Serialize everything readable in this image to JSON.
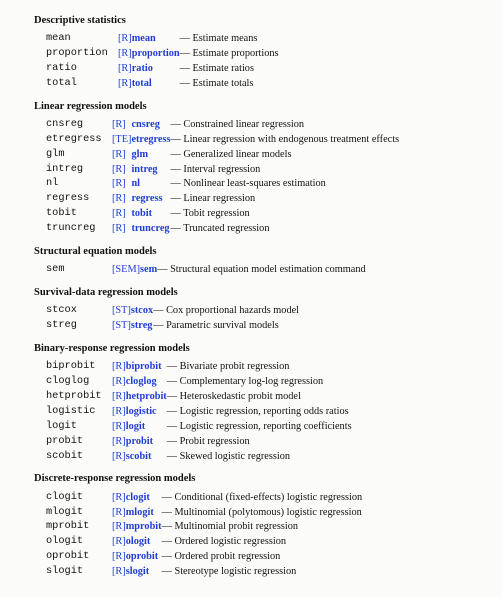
{
  "sections": [
    {
      "title": "Descriptive statistics",
      "cmdWidth": 72,
      "items": [
        {
          "cmd": "mean",
          "ref": "[R]",
          "entry": "mean",
          "desc": "Estimate means"
        },
        {
          "cmd": "proportion",
          "ref": "[R]",
          "entry": "proportion",
          "desc": "Estimate proportions"
        },
        {
          "cmd": "ratio",
          "ref": "[R]",
          "entry": "ratio",
          "desc": "Estimate ratios"
        },
        {
          "cmd": "total",
          "ref": "[R]",
          "entry": "total",
          "desc": "Estimate totals"
        }
      ]
    },
    {
      "title": "Linear regression models",
      "cmdWidth": 66,
      "items": [
        {
          "cmd": "cnsreg",
          "ref": "[R]",
          "entry": "cnsreg",
          "desc": "Constrained linear regression"
        },
        {
          "cmd": "etregress",
          "ref": "[TE]",
          "entry": "etregress",
          "desc": "Linear regression with endogenous treatment effects"
        },
        {
          "cmd": "glm",
          "ref": "[R]",
          "entry": "glm",
          "desc": "Generalized linear models"
        },
        {
          "cmd": "intreg",
          "ref": "[R]",
          "entry": "intreg",
          "desc": "Interval regression"
        },
        {
          "cmd": "nl",
          "ref": "[R]",
          "entry": "nl",
          "desc": "Nonlinear least-squares estimation"
        },
        {
          "cmd": "regress",
          "ref": "[R]",
          "entry": "regress",
          "desc": "Linear regression"
        },
        {
          "cmd": "tobit",
          "ref": "[R]",
          "entry": "tobit",
          "desc": "Tobit regression"
        },
        {
          "cmd": "truncreg",
          "ref": "[R]",
          "entry": "truncreg",
          "desc": "Truncated regression"
        }
      ]
    },
    {
      "title": "Structural equation models",
      "cmdWidth": 66,
      "items": [
        {
          "cmd": "sem",
          "ref": "[SEM]",
          "entry": "sem",
          "desc": "Structural equation model estimation command"
        }
      ]
    },
    {
      "title": "Survival-data regression models",
      "cmdWidth": 66,
      "items": [
        {
          "cmd": "stcox",
          "ref": "[ST]",
          "entry": "stcox",
          "desc": "Cox proportional hazards model"
        },
        {
          "cmd": "streg",
          "ref": "[ST]",
          "entry": "streg",
          "desc": "Parametric survival models"
        }
      ]
    },
    {
      "title": "Binary-response regression models",
      "cmdWidth": 66,
      "items": [
        {
          "cmd": "biprobit",
          "ref": "[R]",
          "entry": "biprobit",
          "desc": "Bivariate probit regression"
        },
        {
          "cmd": "cloglog",
          "ref": "[R]",
          "entry": "cloglog",
          "desc": "Complementary log-log regression"
        },
        {
          "cmd": "hetprobit",
          "ref": "[R]",
          "entry": "hetprobit",
          "desc": "Heteroskedastic probit model"
        },
        {
          "cmd": "logistic",
          "ref": "[R]",
          "entry": "logistic",
          "desc": "Logistic regression, reporting odds ratios"
        },
        {
          "cmd": "logit",
          "ref": "[R]",
          "entry": "logit",
          "desc": "Logistic regression, reporting coefficients"
        },
        {
          "cmd": "probit",
          "ref": "[R]",
          "entry": "probit",
          "desc": "Probit regression"
        },
        {
          "cmd": "scobit",
          "ref": "[R]",
          "entry": "scobit",
          "desc": "Skewed logistic regression"
        }
      ]
    },
    {
      "title": "Discrete-response regression models",
      "cmdWidth": 66,
      "items": [
        {
          "cmd": "clogit",
          "ref": "[R]",
          "entry": "clogit",
          "desc": "Conditional (fixed-effects) logistic regression"
        },
        {
          "cmd": "mlogit",
          "ref": "[R]",
          "entry": "mlogit",
          "desc": "Multinomial (polytomous) logistic regression"
        },
        {
          "cmd": "mprobit",
          "ref": "[R]",
          "entry": "mprobit",
          "desc": "Multinomial probit regression"
        },
        {
          "cmd": "ologit",
          "ref": "[R]",
          "entry": "ologit",
          "desc": "Ordered logistic regression"
        },
        {
          "cmd": "oprobit",
          "ref": "[R]",
          "entry": "oprobit",
          "desc": "Ordered probit regression"
        },
        {
          "cmd": "slogit",
          "ref": "[R]",
          "entry": "slogit",
          "desc": "Stereotype logistic regression"
        }
      ]
    }
  ]
}
